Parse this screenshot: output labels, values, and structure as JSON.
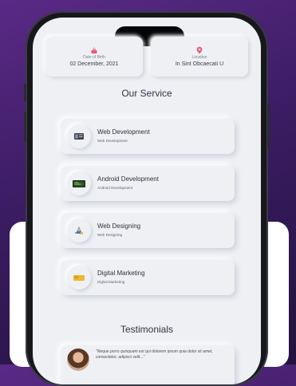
{
  "profile": {
    "dob_label": "Date of Birth",
    "dob_value": "02 December, 2021",
    "location_label": "Location",
    "location_value": "In Sint Obcaecati U"
  },
  "services": {
    "title": "Our Service",
    "items": [
      {
        "title": "Web Development",
        "subtitle": "Web Development",
        "icon": "web-development-icon"
      },
      {
        "title": "Android Development",
        "subtitle": "Android Development",
        "icon": "android-development-icon"
      },
      {
        "title": "Web Designing",
        "subtitle": "Web Designing",
        "icon": "web-designing-icon"
      },
      {
        "title": "Digital Marketing",
        "subtitle": "Digital Marketing",
        "icon": "digital-marketing-icon"
      }
    ]
  },
  "testimonials": {
    "title": "Testimonials",
    "quote": "\"Neque porro quisquam est qui dolorem ipsum quia dolor sit amet, consectetur, adipisci velit...\""
  },
  "colors": {
    "background": "#3b1c63",
    "screen": "#eef0f4",
    "accent": "#e85a7a"
  }
}
